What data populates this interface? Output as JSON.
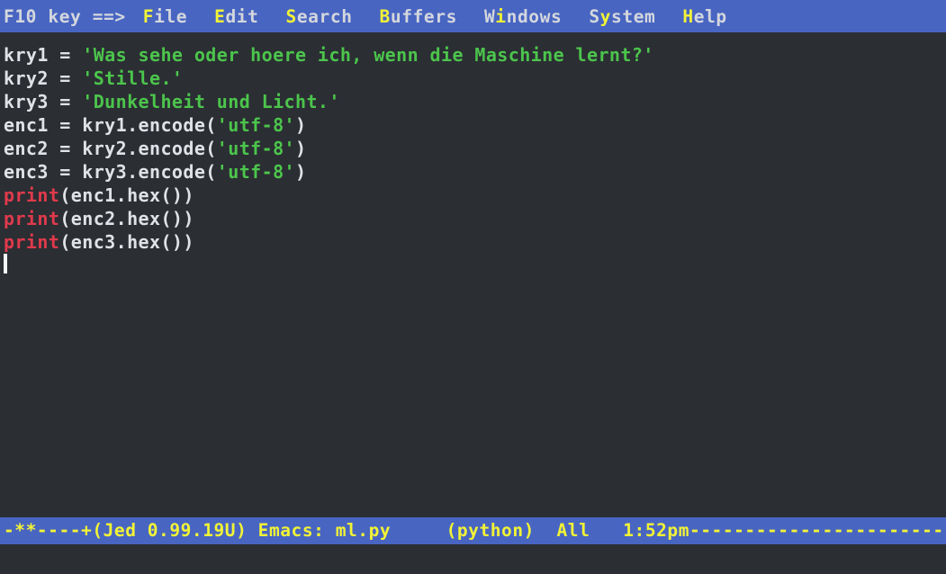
{
  "menubar": {
    "prompt": "F10 key ==>",
    "items": [
      {
        "label": "File",
        "hot_index": 0
      },
      {
        "label": "Edit",
        "hot_index": 0
      },
      {
        "label": "Search",
        "hot_index": 0
      },
      {
        "label": "Buffers",
        "hot_index": 0
      },
      {
        "label": "Windows",
        "hot_index": 1
      },
      {
        "label": "System",
        "hot_index": 1
      },
      {
        "label": "Help",
        "hot_index": 0
      }
    ]
  },
  "buffer": {
    "lines": [
      [
        {
          "text": "kry1 = ",
          "type": "plain"
        },
        {
          "text": "'Was sehe oder hoere ich, wenn die Maschine lernt?'",
          "type": "string"
        }
      ],
      [
        {
          "text": "kry2 = ",
          "type": "plain"
        },
        {
          "text": "'Stille.'",
          "type": "string"
        }
      ],
      [
        {
          "text": "kry3 = ",
          "type": "plain"
        },
        {
          "text": "'Dunkelheit und Licht.'",
          "type": "string"
        }
      ],
      [
        {
          "text": "enc1 = kry1.encode(",
          "type": "plain"
        },
        {
          "text": "'utf-8'",
          "type": "string"
        },
        {
          "text": ")",
          "type": "plain"
        }
      ],
      [
        {
          "text": "enc2 = kry2.encode(",
          "type": "plain"
        },
        {
          "text": "'utf-8'",
          "type": "string"
        },
        {
          "text": ")",
          "type": "plain"
        }
      ],
      [
        {
          "text": "enc3 = kry3.encode(",
          "type": "plain"
        },
        {
          "text": "'utf-8'",
          "type": "string"
        },
        {
          "text": ")",
          "type": "plain"
        }
      ],
      [
        {
          "text": "print",
          "type": "keyword"
        },
        {
          "text": "(enc1.hex())",
          "type": "plain"
        }
      ],
      [
        {
          "text": "print",
          "type": "keyword"
        },
        {
          "text": "(enc2.hex())",
          "type": "plain"
        }
      ],
      [
        {
          "text": "print",
          "type": "keyword"
        },
        {
          "text": "(enc3.hex())",
          "type": "plain"
        }
      ]
    ]
  },
  "statusline": {
    "text": "-**----+(Jed 0.99.19U) Emacs: ml.py     (python)  All   1:52pm--------------------------",
    "flags": "-**----+",
    "editor": "(Jed 0.99.19U)",
    "emulation": "Emacs:",
    "filename": "ml.py",
    "mode": "(python)",
    "scroll_position": "All",
    "time": "1:52pm"
  },
  "minibuffer": {
    "text": ""
  },
  "colors": {
    "menubar_bg": "#4865c2",
    "statusline_bg": "#4865c2",
    "buffer_bg": "#2b2e33",
    "text_fg": "#dfe2e7",
    "string_fg": "#4cc54c",
    "keyword_fg": "#e03a4c",
    "hotkey_fg": "#f2f336",
    "statusline_fg": "#f2f336",
    "cursor_fg": "#f3f5f8"
  }
}
